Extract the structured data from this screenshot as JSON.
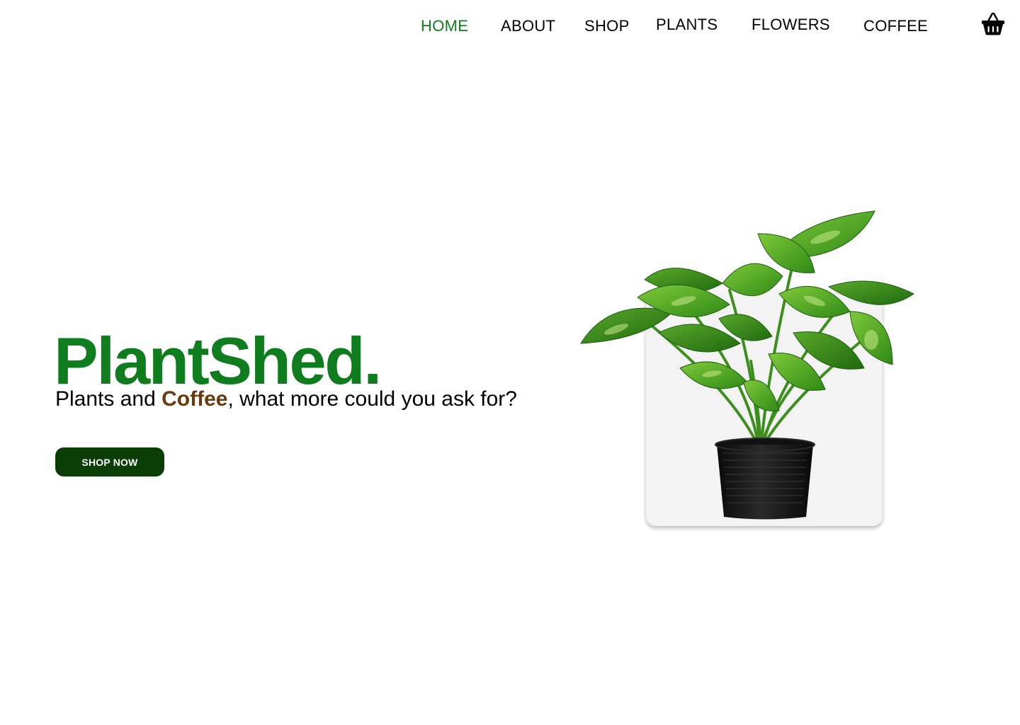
{
  "nav": {
    "items": [
      {
        "label": "HOME",
        "active": true
      },
      {
        "label": "ABOUT",
        "active": false
      },
      {
        "label": "SHOP",
        "active": false
      },
      {
        "label": "PLANTS",
        "active": false
      },
      {
        "label": "FLOWERS",
        "active": false
      },
      {
        "label": "COFFEE",
        "active": false
      }
    ],
    "cart_icon": "basket-icon"
  },
  "hero": {
    "brand": "PlantShed.",
    "tagline": {
      "before": "Plants and ",
      "highlight": "Coffee",
      "after": ", what more could you ask for?"
    },
    "cta_label": "SHOP NOW",
    "product_image": "potted-pothos-plant"
  },
  "colors": {
    "brand_green": "#0f7d1e",
    "button_green": "#0b3d07",
    "coffee_brown": "#6a3a0c",
    "card_bg": "#f3f3f3"
  }
}
